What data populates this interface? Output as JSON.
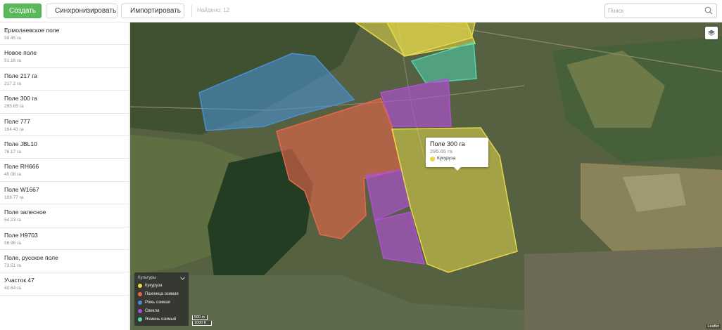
{
  "toolbar": {
    "create_label": "Создать",
    "sync_label": "Синхронизировать",
    "import_label": "Импортировать",
    "found_text": "Найдено: 12",
    "search_placeholder": "Поиск"
  },
  "sidebar": {
    "fields": [
      {
        "name": "Ермолаевское поле",
        "area": "59.45 га"
      },
      {
        "name": "Новое поле",
        "area": "51.16 га"
      },
      {
        "name": "Поле 217 га",
        "area": "217.2 га"
      },
      {
        "name": "Поле 300 га",
        "area": "295.65 га"
      },
      {
        "name": "Поле 777",
        "area": "164.43 га"
      },
      {
        "name": "Поле JBL10",
        "area": "76.17 га"
      },
      {
        "name": "Поле RH666",
        "area": "40.08 га"
      },
      {
        "name": "Поле W1667",
        "area": "106.77 га"
      },
      {
        "name": "Поле залесное",
        "area": "54.23 га"
      },
      {
        "name": "Поле H9703",
        "area": "58.96 га"
      },
      {
        "name": "Поле, русское поле",
        "area": "73.51 га"
      },
      {
        "name": "Участок 47",
        "area": "40.64 га"
      }
    ]
  },
  "map": {
    "popup": {
      "title": "Поле 300 га",
      "area": "295.65 га",
      "crop": "Кукуруза"
    },
    "legend": {
      "title": "Культуры",
      "items": [
        {
          "label": "Кукуруза",
          "color": "#e6d84a"
        },
        {
          "label": "Пшеница озимая",
          "color": "#e8664a"
        },
        {
          "label": "Рожь озимая",
          "color": "#4a8fd0"
        },
        {
          "label": "Свекла",
          "color": "#b04fd6"
        },
        {
          "label": "Ячмень озимый",
          "color": "#4fd6b0"
        }
      ]
    },
    "scale": {
      "metric": "500 m",
      "imperial": "1000 ft"
    },
    "attribution": "Leaflet"
  },
  "colors": {
    "create_button": "#5cb85c",
    "corn": "#e6d84a",
    "winter_wheat": "#e8664a",
    "winter_rye": "#4a8fd0",
    "beet": "#b04fd6",
    "winter_barley": "#4fd6b0"
  }
}
